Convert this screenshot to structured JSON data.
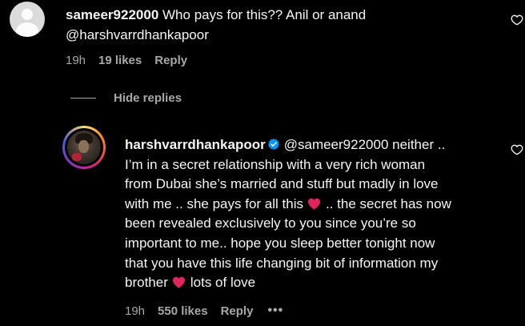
{
  "comment": {
    "username": "sameer922000",
    "text_line1": "Who pays for this?? Anil or anand",
    "text_line2": "@harshvarrdhankapoor",
    "time": "19h",
    "likes": "19 likes",
    "reply_label": "Reply"
  },
  "hide_replies_label": "Hide replies",
  "reply": {
    "username": "harshvarrdhankapoor",
    "mention": "@sameer922000",
    "segment1": "neither ..",
    "segment2": "I’m in a secret relationship with a very rich woman",
    "segment3": "from Dubai she’s married and stuff but madly in love",
    "segment4": "with me .. she pays for all this",
    "segment5": ".. the secret has now",
    "segment6": "been revealed exclusively to you since you’re so",
    "segment7": "important to me.. hope you sleep better tonight now",
    "segment8": "that you have this life changing bit of information my",
    "segment9": "brother",
    "segment10": "lots of love",
    "time": "19h",
    "likes": "550 likes",
    "reply_label": "Reply",
    "more_label": "•••"
  },
  "colors": {
    "background": "#000000",
    "primary_text": "#f5f5f5",
    "secondary_text": "#a8a8a8",
    "verified_blue": "#0095f6",
    "heart_red": "#e0245e"
  },
  "icons": {
    "like": "heart-outline-icon",
    "verified": "verified-badge-icon",
    "emoji": "red-heart-emoji"
  }
}
